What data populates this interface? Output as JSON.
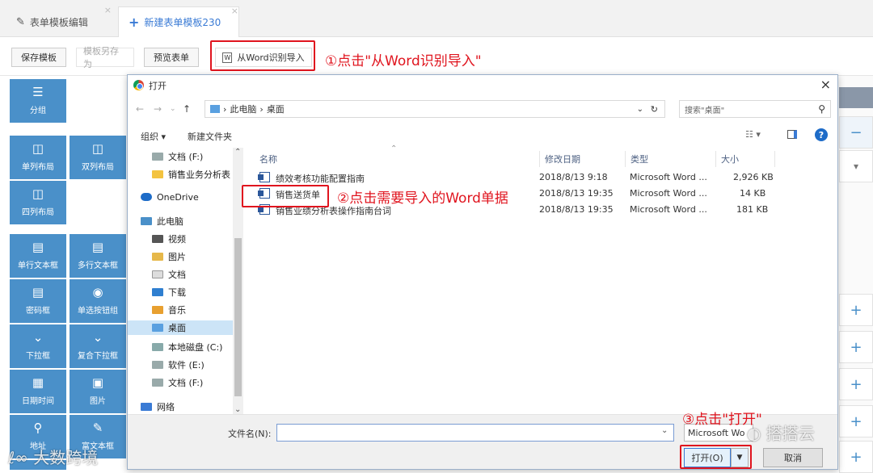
{
  "tabs": [
    {
      "label": "表单模板编辑",
      "close": "×"
    },
    {
      "label": "新建表单模板230",
      "close": "×"
    }
  ],
  "toolbar": {
    "save": "保存模板",
    "save_as": "模板另存为",
    "preview": "预览表单",
    "import_word": "从Word识别导入"
  },
  "annotations": {
    "step1": "①点击\"从Word识别导入\"",
    "step2": "②点击需要导入的Word单据",
    "step3": "③点击\"打开\""
  },
  "sidebar": [
    {
      "label": "分组",
      "icon": "list-icon"
    },
    {
      "label": "单列布局",
      "icon": "column-icon"
    },
    {
      "label": "双列布局",
      "icon": "column-icon"
    },
    {
      "label": "四列布局",
      "icon": "column-icon"
    },
    {
      "label": "单行文本框",
      "icon": "doc-icon"
    },
    {
      "label": "多行文本框",
      "icon": "doc-icon"
    },
    {
      "label": "密码框",
      "icon": "doc-icon"
    },
    {
      "label": "单选按钮组",
      "icon": "radio-icon"
    },
    {
      "label": "下拉框",
      "icon": "chevron-down-icon"
    },
    {
      "label": "复合下拉框",
      "icon": "chevron-down-icon"
    },
    {
      "label": "日期时间",
      "icon": "calendar-icon"
    },
    {
      "label": "图片",
      "icon": "image-icon"
    },
    {
      "label": "地址",
      "icon": "pin-icon"
    },
    {
      "label": "富文本框",
      "icon": "edit-icon"
    }
  ],
  "dialog": {
    "title": "打开",
    "close": "×",
    "path": [
      "此电脑",
      "桌面"
    ],
    "search_placeholder": "搜索\"桌面\"",
    "organize": "组织 ▾",
    "new_folder": "新建文件夹",
    "nav_items": [
      {
        "label": "文档 (F:)",
        "indent": 1
      },
      {
        "label": "销售业务分析表",
        "indent": 1
      },
      {
        "label": "OneDrive",
        "indent": 0
      },
      {
        "label": "此电脑",
        "indent": 0
      },
      {
        "label": "视频",
        "indent": 1
      },
      {
        "label": "图片",
        "indent": 1
      },
      {
        "label": "文档",
        "indent": 1
      },
      {
        "label": "下载",
        "indent": 1
      },
      {
        "label": "音乐",
        "indent": 1
      },
      {
        "label": "桌面",
        "indent": 1,
        "selected": true
      },
      {
        "label": "本地磁盘 (C:)",
        "indent": 1
      },
      {
        "label": "软件 (E:)",
        "indent": 1
      },
      {
        "label": "文档 (F:)",
        "indent": 1
      },
      {
        "label": "网络",
        "indent": 0
      }
    ],
    "columns": {
      "name": "名称",
      "date": "修改日期",
      "type": "类型",
      "size": "大小"
    },
    "files": [
      {
        "name": "绩效考核功能配置指南",
        "date": "2018/8/13 9:18",
        "type": "Microsoft Word ...",
        "size": "2,926 KB"
      },
      {
        "name": "销售送货单",
        "date": "2018/8/13 19:35",
        "type": "Microsoft Word ...",
        "size": "14 KB"
      },
      {
        "name": "销售业绩分析表操作指南台词",
        "date": "2018/8/13 19:35",
        "type": "Microsoft Word ...",
        "size": "181 KB"
      }
    ],
    "filename_label": "文件名(N):",
    "filename_value": "",
    "filetype": "Microsoft Wo",
    "open": "打开(O)",
    "cancel": "取消"
  },
  "watermarks": [
    "大数跨境",
    "搭搭云"
  ],
  "colors": {
    "accent": "#4a90c9",
    "annotation": "#e0141e"
  }
}
